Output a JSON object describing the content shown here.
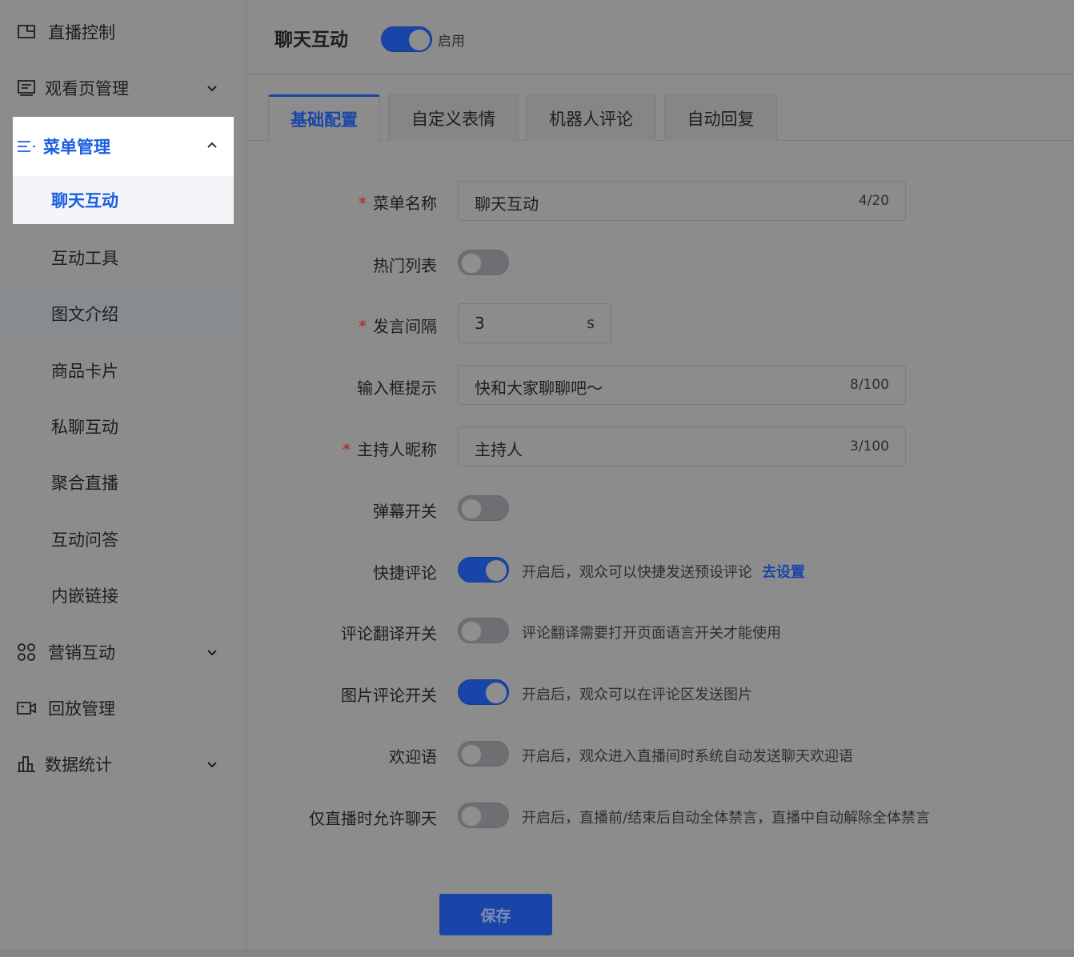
{
  "sidebar": {
    "items": [
      {
        "label": "直播控制",
        "icon": "monitor-icon"
      },
      {
        "label": "观看页管理",
        "icon": "window-icon"
      },
      {
        "label": "菜单管理",
        "icon": "menu-list-icon"
      },
      {
        "label": "营销互动",
        "icon": "grid-icon"
      },
      {
        "label": "回放管理",
        "icon": "video-icon"
      },
      {
        "label": "数据统计",
        "icon": "bar-chart-icon"
      }
    ],
    "sub_items": [
      "聊天互动",
      "互动工具",
      "图文介绍",
      "商品卡片",
      "私聊互动",
      "聚合直播",
      "互动问答",
      "内嵌链接"
    ]
  },
  "header": {
    "title": "聊天互动",
    "toggle_label": "启用",
    "toggle_on": true
  },
  "tabs": [
    "基础配置",
    "自定义表情",
    "机器人评论",
    "自动回复"
  ],
  "active_tab": "基础配置",
  "form": {
    "menu_name": {
      "label": "菜单名称",
      "value": "聊天互动",
      "count": "4/20"
    },
    "hot_list": {
      "label": "热门列表",
      "on": false
    },
    "interval": {
      "label": "发言间隔",
      "value": "3",
      "unit": "s"
    },
    "input_hint": {
      "label": "输入框提示",
      "value": "快和大家聊聊吧～",
      "count": "8/100"
    },
    "host_nick": {
      "label": "主持人昵称",
      "value": "主持人",
      "count": "3/100"
    },
    "barrage": {
      "label": "弹幕开关",
      "on": false
    },
    "quick_comment": {
      "label": "快捷评论",
      "on": true,
      "hint": "开启后，观众可以快捷发送预设评论",
      "link": "去设置"
    },
    "translate": {
      "label": "评论翻译开关",
      "on": false,
      "hint": "评论翻译需要打开页面语言开关才能使用"
    },
    "image_comment": {
      "label": "图片评论开关",
      "on": true,
      "hint": "开启后，观众可以在评论区发送图片"
    },
    "welcome": {
      "label": "欢迎语",
      "on": false,
      "hint": "开启后，观众进入直播间时系统自动发送聊天欢迎语"
    },
    "live_only": {
      "label": "仅直播时允许聊天",
      "on": false,
      "hint": "开启后，直播前/结束后自动全体禁言，直播中自动解除全体禁言"
    },
    "required_mark": "*"
  },
  "save_label": "保存",
  "colors": {
    "accent": "#1a5fe0",
    "switch_on": "#1a45a8",
    "required": "#b02020"
  }
}
